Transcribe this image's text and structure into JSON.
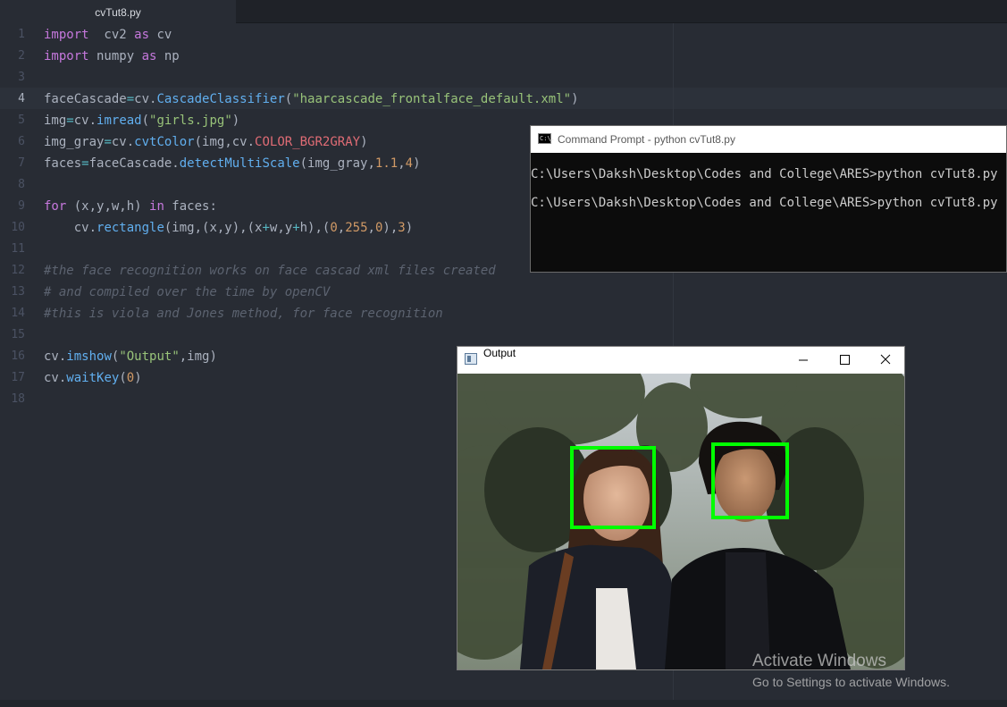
{
  "editor": {
    "tab_title": "cvTut8.py",
    "current_line": 4,
    "line_numbers": [
      "1",
      "2",
      "3",
      "4",
      "5",
      "6",
      "7",
      "8",
      "9",
      "10",
      "11",
      "12",
      "13",
      "14",
      "15",
      "16",
      "17",
      "18"
    ],
    "lines": [
      [
        [
          "kw",
          "import"
        ],
        [
          "",
          "  cv2 "
        ],
        [
          "kw",
          "as"
        ],
        [
          "",
          " cv"
        ]
      ],
      [
        [
          "kw",
          "import"
        ],
        [
          "",
          " numpy "
        ],
        [
          "kw",
          "as"
        ],
        [
          "",
          " np"
        ]
      ],
      [],
      [
        [
          "",
          "faceCascade"
        ],
        [
          "op",
          "="
        ],
        [
          "",
          "cv."
        ],
        [
          "fn",
          "CascadeClassifier"
        ],
        [
          "",
          "("
        ],
        [
          "str",
          "\"haarcascade_frontalface_default.xml\""
        ],
        [
          "",
          ")"
        ]
      ],
      [
        [
          "",
          "img"
        ],
        [
          "op",
          "="
        ],
        [
          "",
          "cv."
        ],
        [
          "fn",
          "imread"
        ],
        [
          "",
          "("
        ],
        [
          "str",
          "\"girls.jpg\""
        ],
        [
          "",
          ")"
        ]
      ],
      [
        [
          "",
          "img_gray"
        ],
        [
          "op",
          "="
        ],
        [
          "",
          "cv."
        ],
        [
          "fn",
          "cvtColor"
        ],
        [
          "",
          "(img,cv."
        ],
        [
          "cst",
          "COLOR_BGR2GRAY"
        ],
        [
          "",
          ")"
        ]
      ],
      [
        [
          "",
          "faces"
        ],
        [
          "op",
          "="
        ],
        [
          "",
          "faceCascade."
        ],
        [
          "fn",
          "detectMultiScale"
        ],
        [
          "",
          "(img_gray,"
        ],
        [
          "num",
          "1.1"
        ],
        [
          "",
          ","
        ],
        [
          "num",
          "4"
        ],
        [
          "",
          ")"
        ]
      ],
      [],
      [
        [
          "kw",
          "for"
        ],
        [
          "",
          " (x,y,w,h) "
        ],
        [
          "kw",
          "in"
        ],
        [
          "",
          " faces:"
        ]
      ],
      [
        [
          "",
          "    cv."
        ],
        [
          "fn",
          "rectangle"
        ],
        [
          "",
          "(img,(x,y),(x"
        ],
        [
          "op",
          "+"
        ],
        [
          "",
          "w,y"
        ],
        [
          "op",
          "+"
        ],
        [
          "",
          "h),("
        ],
        [
          "num",
          "0"
        ],
        [
          "",
          ","
        ],
        [
          "num",
          "255"
        ],
        [
          "",
          ","
        ],
        [
          "num",
          "0"
        ],
        [
          "",
          "),"
        ],
        [
          "num",
          "3"
        ],
        [
          "",
          ")"
        ]
      ],
      [],
      [
        [
          "cm",
          "#the face recognition works on face cascad xml files created"
        ]
      ],
      [
        [
          "cm",
          "# and compiled over the time by openCV"
        ]
      ],
      [
        [
          "cm",
          "#this is viola and Jones method, for face recognition"
        ]
      ],
      [],
      [
        [
          "",
          "cv."
        ],
        [
          "fn",
          "imshow"
        ],
        [
          "",
          "("
        ],
        [
          "str",
          "\"Output\""
        ],
        [
          "",
          ",img)"
        ]
      ],
      [
        [
          "",
          "cv."
        ],
        [
          "fn",
          "waitKey"
        ],
        [
          "",
          "("
        ],
        [
          "num",
          "0"
        ],
        [
          "",
          ")"
        ]
      ],
      []
    ]
  },
  "cmd": {
    "icon_text": "C:\\.",
    "title": "Command Prompt - python  cvTut8.py",
    "lines": [
      "C:\\Users\\Daksh\\Desktop\\Codes and College\\ARES>python cvTut8.py",
      "C:\\Users\\Daksh\\Desktop\\Codes and College\\ARES>python cvTut8.py"
    ]
  },
  "output_window": {
    "title": "Output",
    "icon": "opencv-window-icon",
    "buttons": [
      "minimize-icon",
      "maximize-icon",
      "close-icon"
    ],
    "photo": "photo-two-people-outdoors-trees",
    "detection_box_color": "#00ff00",
    "detections": 2
  },
  "watermark": {
    "line1": "Activate Windows",
    "line2": "Go to Settings to activate Windows."
  },
  "colors": {
    "editor_bg": "#282c34",
    "keyword": "#c678dd",
    "function": "#61afef",
    "string": "#98c379",
    "number": "#d19a66",
    "constant": "#e06c75",
    "operator": "#56b6c2",
    "comment": "#5c6370"
  }
}
